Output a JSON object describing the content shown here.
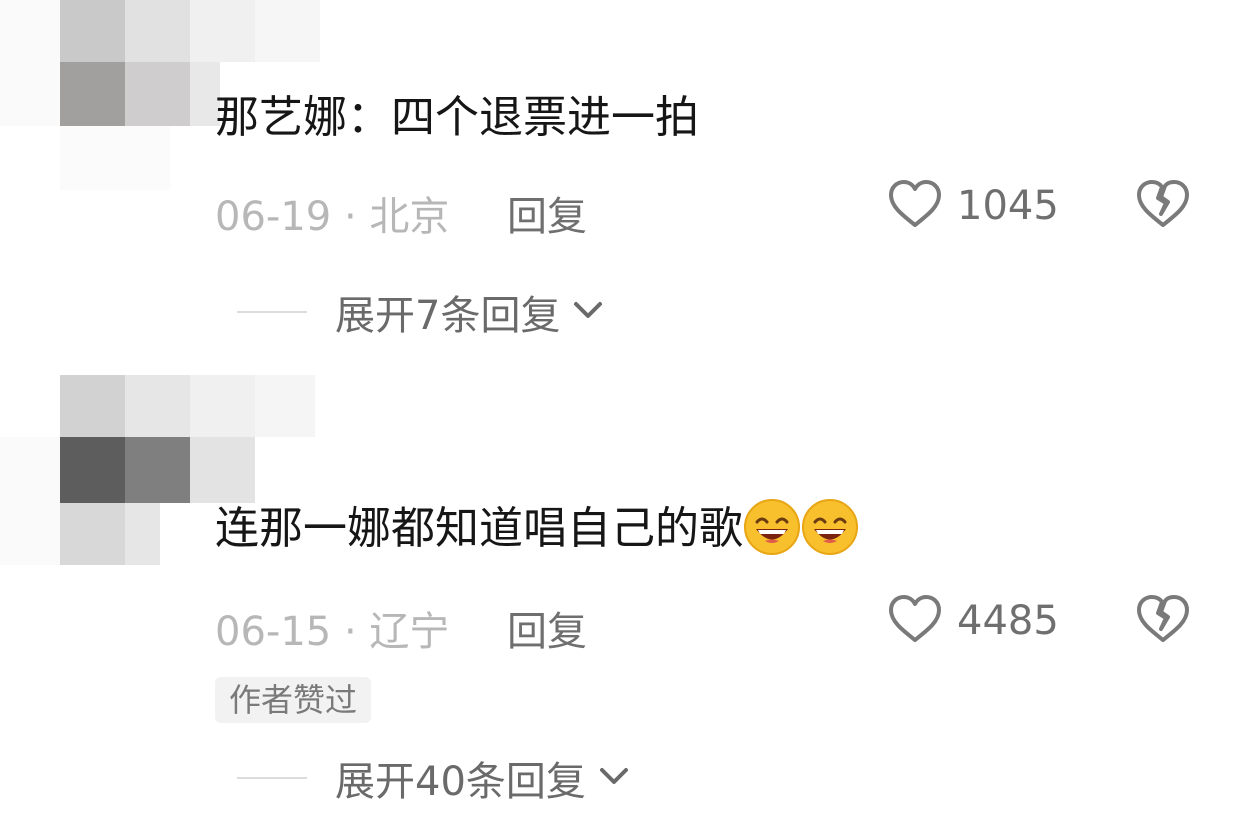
{
  "comments": [
    {
      "text": "那艺娜：四个退票进一拍",
      "date_location": "06-19 · 北京",
      "reply_label": "回复",
      "like_count": "1045",
      "expand_label": "展开7条回复"
    },
    {
      "text": "连那一娜都知道唱自己的歌",
      "emojis": [
        "grin-emoji",
        "grin-emoji"
      ],
      "date_location": "06-15 · 辽宁",
      "reply_label": "回复",
      "like_count": "4485",
      "badge": "作者赞过",
      "expand_label": "展开40条回复"
    }
  ],
  "icons": {
    "like": "heart-outline-icon",
    "dislike": "broken-heart-icon",
    "expand": "chevron-down-icon"
  },
  "colors": {
    "text_primary": "#161616",
    "text_muted": "#b7b7b7",
    "text_secondary": "#6f6f6f",
    "badge_bg": "#f2f2f2"
  }
}
